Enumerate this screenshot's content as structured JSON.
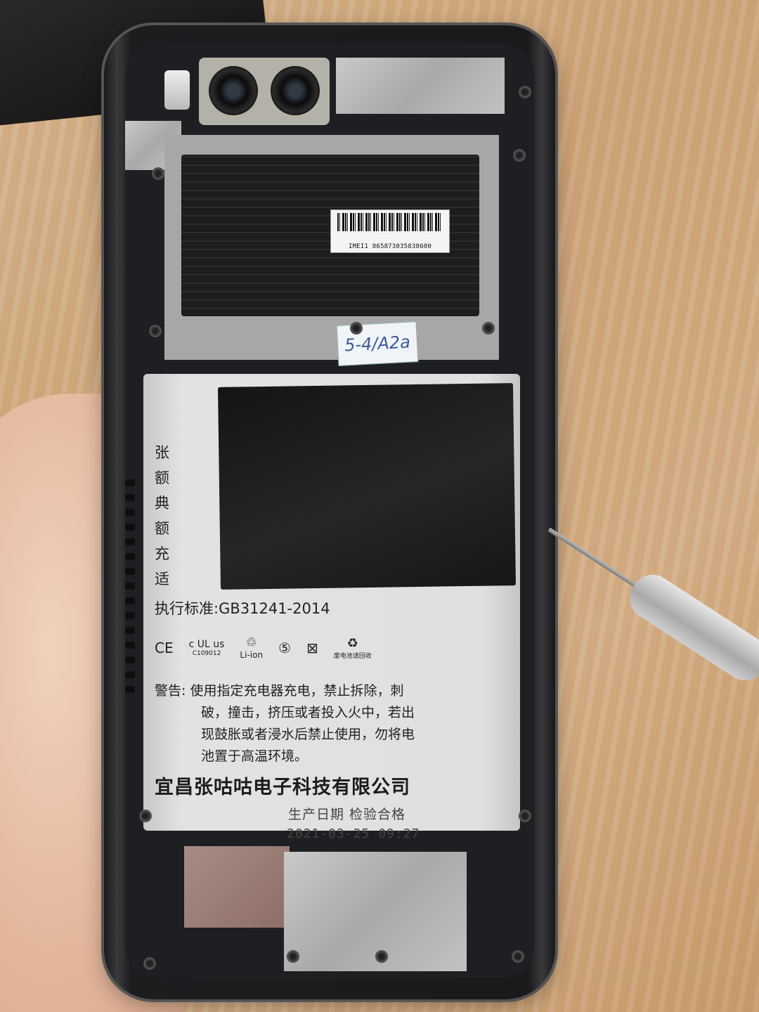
{
  "photo": {
    "subject": "phone-back-battery",
    "imei_label": "IMEI1 865873035838600",
    "sticker_text": "5-4/A2a",
    "battery": {
      "side_labels": [
        "张",
        "额",
        "典",
        "额",
        "充",
        "适"
      ],
      "standard": "执行标准:GB31241-2014",
      "certifications": {
        "ce": "CE",
        "ul": "c UL us",
        "ul_code": "C109012",
        "li_ion": "Li-ion",
        "recycle_mark": "⑤",
        "bin_mark": "⊠",
        "recycle_text": "废电池请回收"
      },
      "warning_lines": [
        "警告: 使用指定充电器充电，禁止拆除，刺",
        "破，撞击，挤压或者投入火中，若出",
        "现鼓胀或者浸水后禁止使用，勿将电",
        "池置于高温环境。"
      ],
      "company": "宜昌张咕咕电子科技有限公司",
      "production_label": "生产日期  检验合格",
      "production_time": "2021-03-25 09:27"
    },
    "colors": {
      "desk": "#d2aa80",
      "phone_frame": "#1e1f22",
      "shield": "#b5b5b5",
      "battery": "#dedede"
    }
  }
}
